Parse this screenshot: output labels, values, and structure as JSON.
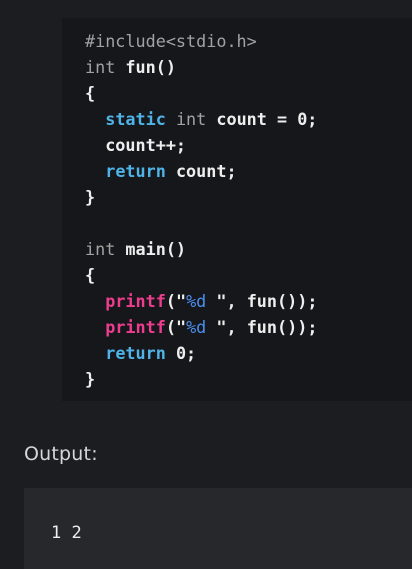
{
  "code": {
    "lines": [
      [
        {
          "t": "#include<stdio.h>",
          "c": "pre"
        }
      ],
      [
        {
          "t": "int",
          "c": "type"
        },
        {
          "t": " fun()",
          "c": "plain"
        }
      ],
      [
        {
          "t": "{",
          "c": "plain"
        }
      ],
      [
        {
          "t": "  ",
          "c": "plain"
        },
        {
          "t": "static",
          "c": "kw"
        },
        {
          "t": " ",
          "c": "plain"
        },
        {
          "t": "int",
          "c": "type"
        },
        {
          "t": " count = 0;",
          "c": "plain"
        }
      ],
      [
        {
          "t": "  count++;",
          "c": "plain"
        }
      ],
      [
        {
          "t": "  ",
          "c": "plain"
        },
        {
          "t": "return",
          "c": "kw"
        },
        {
          "t": " count;",
          "c": "plain"
        }
      ],
      [
        {
          "t": "}",
          "c": "plain"
        }
      ],
      [
        {
          "t": "",
          "c": "plain"
        }
      ],
      [
        {
          "t": "int",
          "c": "type"
        },
        {
          "t": " main()",
          "c": "plain"
        }
      ],
      [
        {
          "t": "{",
          "c": "plain"
        }
      ],
      [
        {
          "t": "  ",
          "c": "plain"
        },
        {
          "t": "printf",
          "c": "fn"
        },
        {
          "t": "(\"",
          "c": "plain"
        },
        {
          "t": "%d",
          "c": "fmt"
        },
        {
          "t": " \", fun());",
          "c": "plain"
        }
      ],
      [
        {
          "t": "  ",
          "c": "plain"
        },
        {
          "t": "printf",
          "c": "fn"
        },
        {
          "t": "(\"",
          "c": "plain"
        },
        {
          "t": "%d",
          "c": "fmt"
        },
        {
          "t": " \", fun());",
          "c": "plain"
        }
      ],
      [
        {
          "t": "  ",
          "c": "plain"
        },
        {
          "t": "return",
          "c": "kw"
        },
        {
          "t": " 0;",
          "c": "plain"
        }
      ],
      [
        {
          "t": "}",
          "c": "plain"
        }
      ]
    ]
  },
  "output": {
    "label": "Output:",
    "text": "1 2"
  },
  "colors": {
    "page_background": "#1b1d20",
    "code_background": "#16171a",
    "output_background": "#26282b",
    "keyword": "#4fb3e8",
    "function": "#ee3d8f",
    "format_specifier": "#4a8ff0",
    "type_and_preprocessor": "#a2a2a2",
    "plain_text": "#eeeeee"
  }
}
